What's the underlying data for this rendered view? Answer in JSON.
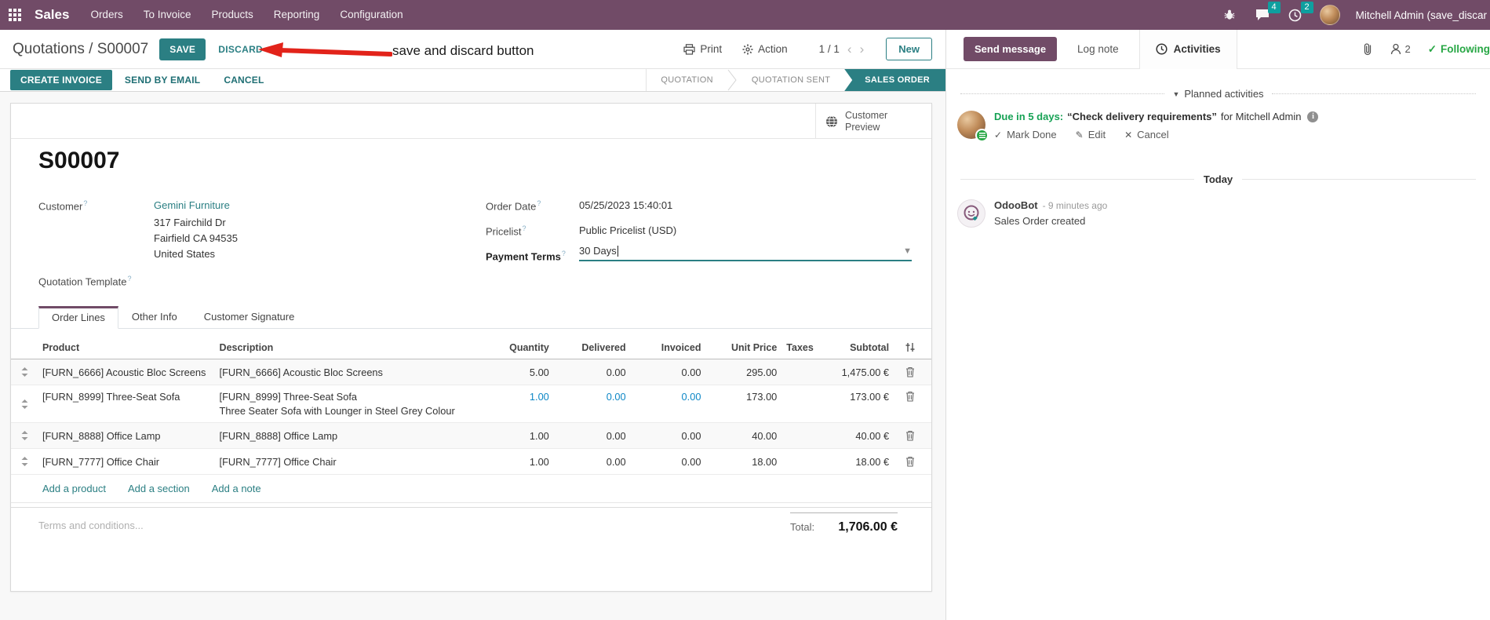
{
  "colors": {
    "navbar": "#714B67",
    "accent_teal": "#2b7f83",
    "badge_teal": "#0f9f9f",
    "edited_blue": "#0d87c6",
    "activity_green": "#28a745",
    "arrow_red": "#e2231a",
    "send_button": "#714B67"
  },
  "nav": {
    "app": "Sales",
    "menus": [
      "Orders",
      "To Invoice",
      "Products",
      "Reporting",
      "Configuration"
    ],
    "messages_badge": "4",
    "activities_badge": "2",
    "user": "Mitchell Admin (save_discar"
  },
  "breadcrumb": {
    "path": "Quotations / S00007",
    "save": "SAVE",
    "discard": "DISCARD",
    "print": "Print",
    "action": "Action",
    "pager": "1 / 1",
    "prev": "‹",
    "next": "›",
    "new": "New"
  },
  "annotation": {
    "text": "save and discard button"
  },
  "statusbar": {
    "create_invoice": "CREATE INVOICE",
    "send_by_email": "SEND BY EMAIL",
    "cancel": "CANCEL",
    "steps": [
      {
        "label": "QUOTATION"
      },
      {
        "label": "QUOTATION SENT"
      },
      {
        "label": "SALES ORDER"
      }
    ]
  },
  "sheet": {
    "customer_preview": "Customer Preview",
    "title": "S00007",
    "customer_label": "Customer",
    "customer_name": "Gemini Furniture",
    "address1": "317 Fairchild Dr",
    "address2": "Fairfield CA 94535",
    "address3": "United States",
    "quotation_template_label": "Quotation Template",
    "order_date_label": "Order Date",
    "order_date": "05/25/2023 15:40:01",
    "pricelist_label": "Pricelist",
    "pricelist": "Public Pricelist (USD)",
    "payment_terms_label": "Payment Terms",
    "payment_terms": "30 Days"
  },
  "tabs": [
    {
      "label": "Order Lines"
    },
    {
      "label": "Other Info"
    },
    {
      "label": "Customer Signature"
    }
  ],
  "order_lines": {
    "headers": {
      "product": "Product",
      "description": "Description",
      "quantity": "Quantity",
      "delivered": "Delivered",
      "invoiced": "Invoiced",
      "unit_price": "Unit Price",
      "taxes": "Taxes",
      "subtotal": "Subtotal"
    },
    "rows": [
      {
        "product": "[FURN_6666] Acoustic Bloc Screens",
        "description": "[FURN_6666] Acoustic Bloc Screens",
        "quantity": "5.00",
        "delivered": "0.00",
        "invoiced": "0.00",
        "unit_price": "295.00",
        "subtotal": "1,475.00 €"
      },
      {
        "product": "[FURN_8999] Three-Seat Sofa",
        "description": "[FURN_8999] Three-Seat Sofa",
        "description2": "Three Seater Sofa with Lounger in Steel Grey Colour",
        "quantity": "1.00",
        "delivered": "0.00",
        "invoiced": "0.00",
        "unit_price": "173.00",
        "subtotal": "173.00 €"
      },
      {
        "product": "[FURN_8888] Office Lamp",
        "description": "[FURN_8888] Office Lamp",
        "quantity": "1.00",
        "delivered": "0.00",
        "invoiced": "0.00",
        "unit_price": "40.00",
        "subtotal": "40.00 €"
      },
      {
        "product": "[FURN_7777] Office Chair",
        "description": "[FURN_7777] Office Chair",
        "quantity": "1.00",
        "delivered": "0.00",
        "invoiced": "0.00",
        "unit_price": "18.00",
        "subtotal": "18.00 €"
      }
    ],
    "links": [
      "Add a product",
      "Add a section",
      "Add a note"
    ],
    "terms_placeholder": "Terms and conditions...",
    "total_label": "Total:",
    "total_value": "1,706.00 €"
  },
  "chatter": {
    "send_message": "Send message",
    "log_note": "Log note",
    "activities": "Activities",
    "followers": "2",
    "following": "Following",
    "planned_header": "Planned activities",
    "activity": {
      "due": "Due in 5 days:",
      "title": "“Check delivery requirements”",
      "for_text": "for Mitchell Admin",
      "mark_done": "Mark Done",
      "edit": "Edit",
      "cancel": "Cancel"
    },
    "today": "Today",
    "message": {
      "author": "OdooBot",
      "time": "- 9 minutes ago",
      "body": "Sales Order created"
    }
  }
}
